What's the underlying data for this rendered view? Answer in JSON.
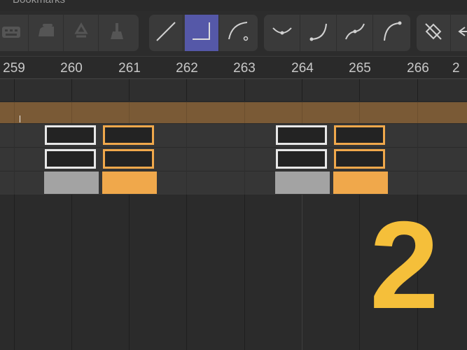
{
  "window": {
    "title": "Bookmarks"
  },
  "toolbar": {
    "groups": [
      {
        "name": "edit-tools",
        "buttons": [
          "keyboard-icon",
          "iron-icon",
          "recycle-icon",
          "broom-icon"
        ]
      },
      {
        "name": "segment-shape",
        "buttons": [
          "linear-icon",
          "corner-icon",
          "ease-out-icon"
        ],
        "active": "corner-icon"
      },
      {
        "name": "curves",
        "buttons": [
          "bezier-dip-icon",
          "curve-up-icon",
          "s-curve-icon",
          "arc-icon"
        ]
      },
      {
        "name": "misc",
        "buttons": [
          "disable-keyframe-icon",
          "arrow-left-icon"
        ]
      }
    ]
  },
  "ruler": {
    "labels": [
      "259",
      "260",
      "261",
      "262",
      "263",
      "264",
      "265",
      "266",
      "2"
    ]
  },
  "timeline": {
    "keyframes": [
      {
        "frame": "260",
        "color": "white"
      },
      {
        "frame": "261",
        "color": "orange"
      },
      {
        "frame": "264",
        "color": "white"
      },
      {
        "frame": "265",
        "color": "orange"
      }
    ],
    "colors": {
      "band": "#7a5a36",
      "white_key": "#e8e8e8",
      "orange_key": "#f0a84b",
      "gray_block": "#a3a3a3"
    }
  },
  "overlay": {
    "big_number": "2",
    "color": "#f5bf3a"
  }
}
